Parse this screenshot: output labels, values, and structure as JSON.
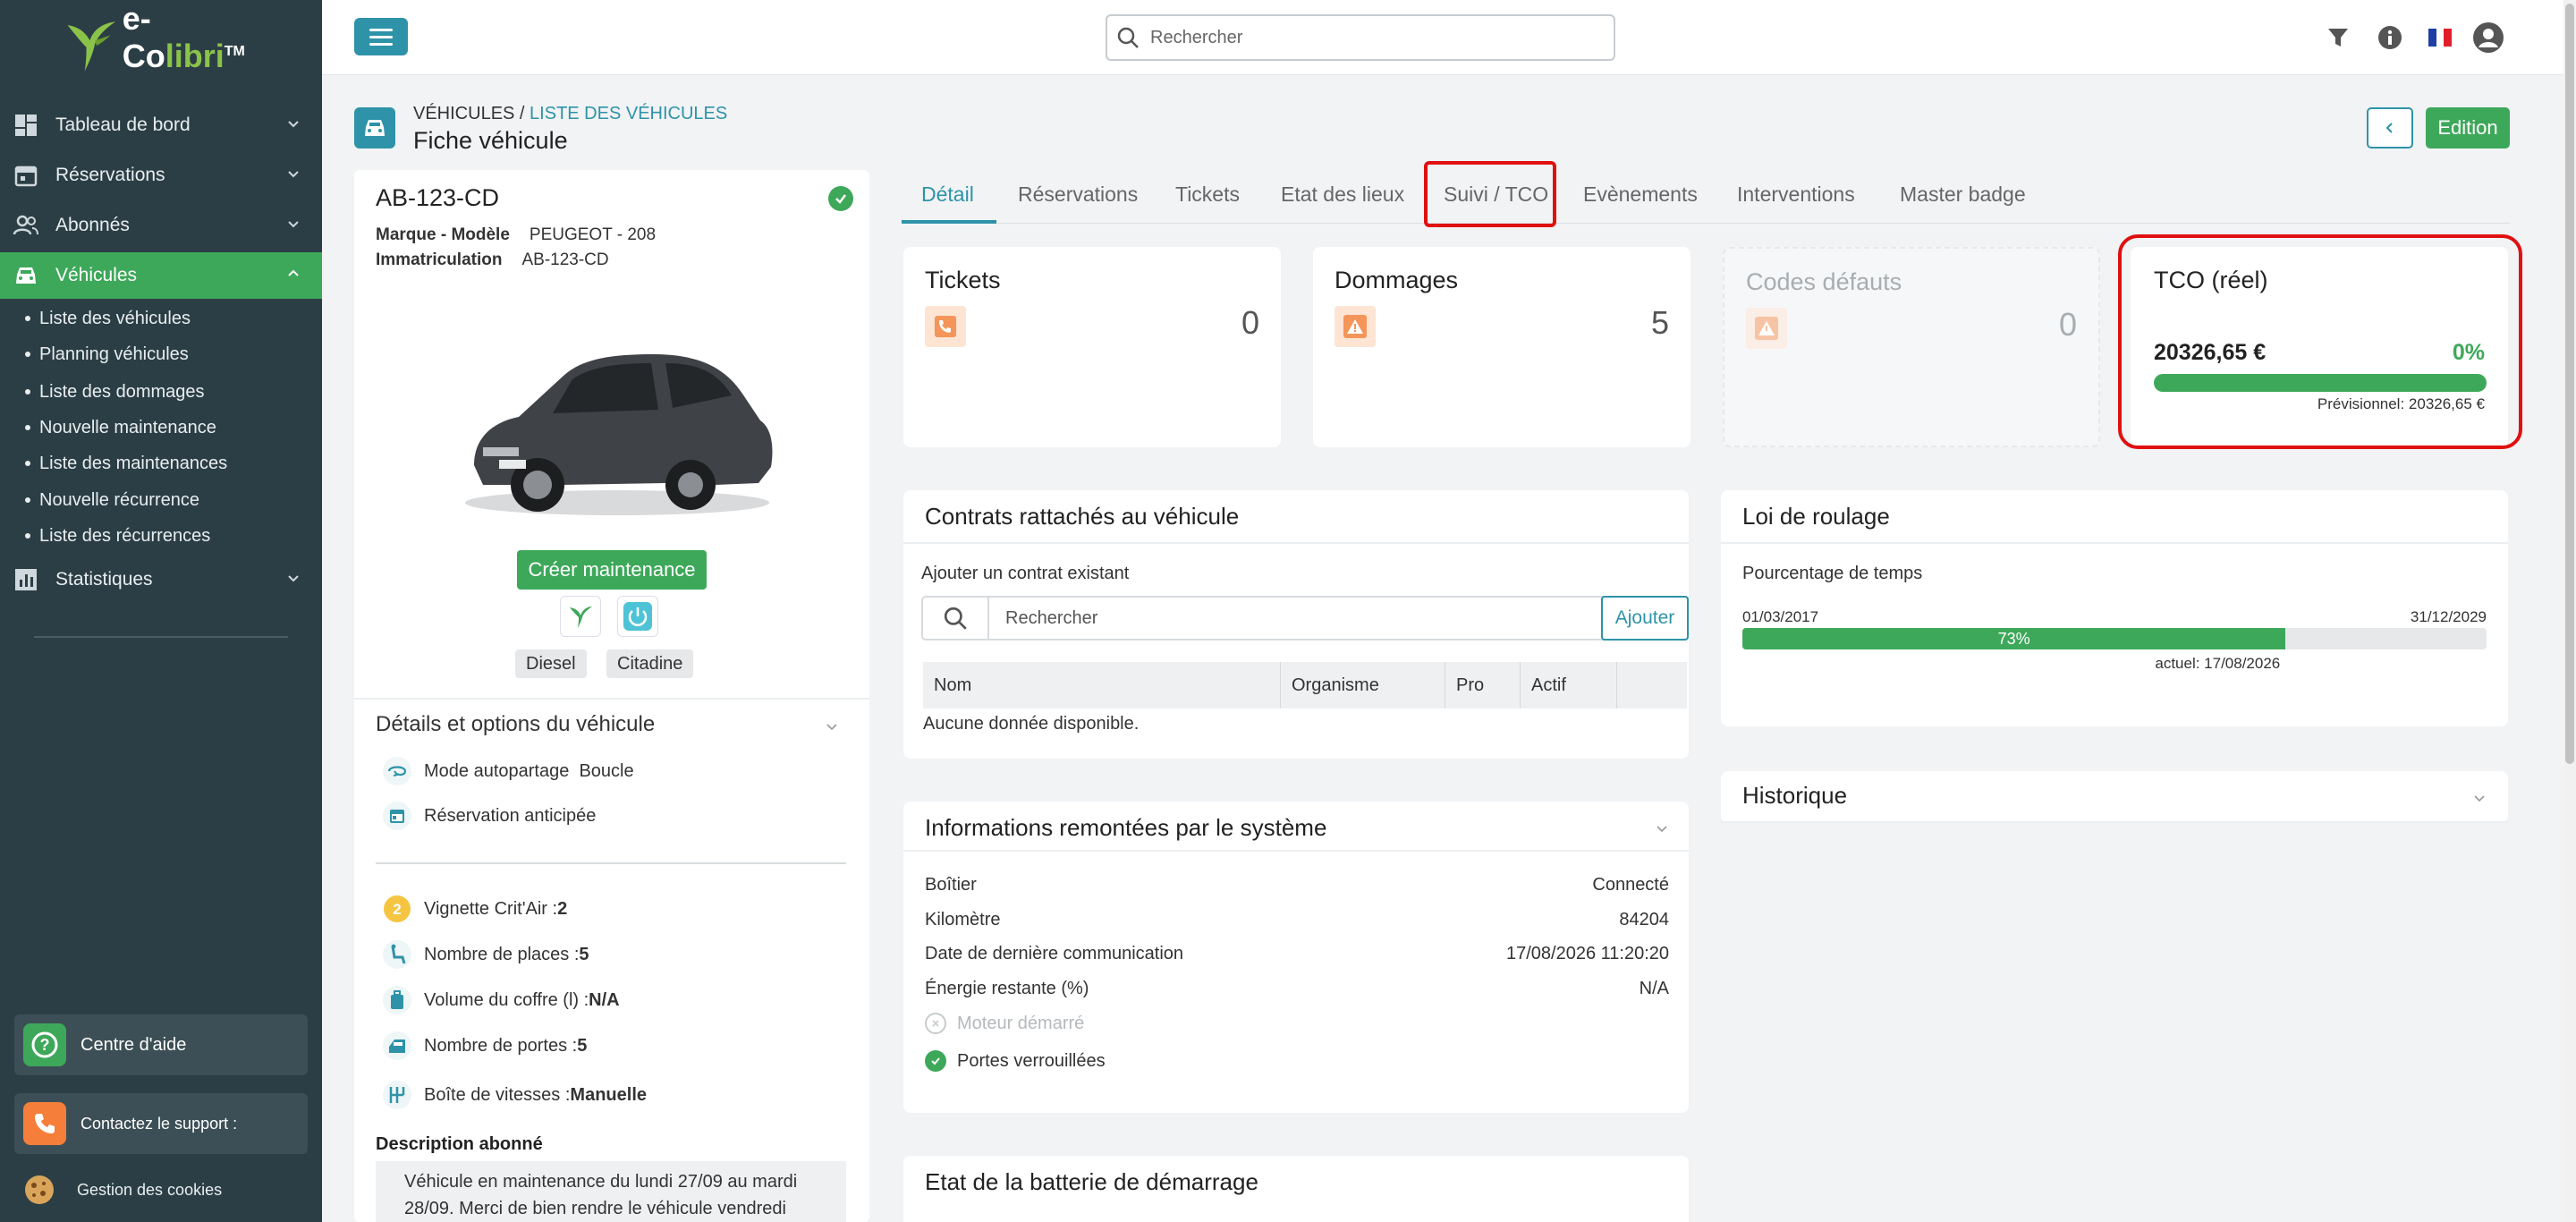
{
  "brand": {
    "name_e": "e-Co",
    "name_c": "libri",
    "tm": "TM"
  },
  "sidebar": {
    "items": [
      {
        "label": "Tableau de bord"
      },
      {
        "label": "Réservations"
      },
      {
        "label": "Abonnés"
      },
      {
        "label": "Véhicules"
      },
      {
        "label": "Statistiques"
      }
    ],
    "sub_items": [
      {
        "label": "Liste des véhicules"
      },
      {
        "label": "Planning véhicules"
      },
      {
        "label": "Liste des dommages"
      },
      {
        "label": "Nouvelle maintenance"
      },
      {
        "label": "Liste des maintenances"
      },
      {
        "label": "Nouvelle récurrence"
      },
      {
        "label": "Liste des récurrences"
      }
    ],
    "help": "Centre d'aide",
    "support": "Contactez le support :",
    "cookies": "Gestion des cookies"
  },
  "topbar": {
    "search_placeholder": "Rechercher"
  },
  "breadcrumb": {
    "root": "VÉHICULES",
    "separator": " / ",
    "link": "LISTE DES VÉHICULES"
  },
  "page_title": "Fiche véhicule",
  "edit_label": "Edition",
  "vehicle": {
    "plate": "AB-123-CD",
    "model_label": "Marque - Modèle",
    "model_value": "PEUGEOT - 208",
    "reg_label": "Immatriculation",
    "reg_value": "AB-123-CD",
    "create_maintenance": "Créer maintenance",
    "tags": [
      "Diesel",
      "Citadine"
    ],
    "details_title": "Détails et options du véhicule",
    "options": [
      {
        "label": "Mode autopartage",
        "value": "Boucle"
      },
      {
        "label": "Réservation anticipée",
        "value": ""
      }
    ],
    "specs": [
      {
        "label": "Vignette Crit'Air : ",
        "value": "2"
      },
      {
        "label": "Nombre de places : ",
        "value": "5"
      },
      {
        "label": "Volume du coffre (l) : ",
        "value": "N/A"
      },
      {
        "label": "Nombre de portes : ",
        "value": "5"
      },
      {
        "label": "Boîte de vitesses : ",
        "value": "Manuelle"
      }
    ],
    "critair_badge": "2",
    "desc_title": "Description abonné",
    "description": "Véhicule en maintenance du lundi 27/09 au mardi 28/09. Merci de bien rendre le véhicule vendredi"
  },
  "tabs": [
    {
      "label": "Détail"
    },
    {
      "label": "Réservations"
    },
    {
      "label": "Tickets"
    },
    {
      "label": "Etat des lieux"
    },
    {
      "label": "Suivi / TCO"
    },
    {
      "label": "Evènements"
    },
    {
      "label": "Interventions"
    },
    {
      "label": "Master badge"
    }
  ],
  "kpis": {
    "tickets": {
      "title": "Tickets",
      "value": "0"
    },
    "dommages": {
      "title": "Dommages",
      "value": "5"
    },
    "codes": {
      "title": "Codes défauts",
      "value": "0"
    },
    "tco": {
      "title": "TCO (réel)",
      "value": "20326,65 €",
      "percent": "0%",
      "forecast": "Prévisionnel:  20326,65 €"
    }
  },
  "contracts": {
    "title": "Contrats rattachés au véhicule",
    "add_label": "Ajouter un contrat existant",
    "search_placeholder": "Rechercher",
    "add_button": "Ajouter",
    "columns": [
      "Nom",
      "Organisme",
      "Pro",
      "Actif",
      ""
    ],
    "empty": "Aucune donnée disponible."
  },
  "system_info": {
    "title": "Informations remontées par le système",
    "rows": [
      {
        "label": "Boîtier",
        "value": "Connecté"
      },
      {
        "label": "Kilomètre",
        "value": "84204"
      },
      {
        "label": "Date de dernière communication",
        "value": "17/08/2026 11:20:20"
      },
      {
        "label": "Énergie restante (%)",
        "value": "N/A"
      }
    ],
    "engine": "Moteur démarré",
    "doors": "Portes verrouillées"
  },
  "battery": {
    "title": "Etat de la batterie de démarrage"
  },
  "loi": {
    "title": "Loi de roulage",
    "label": "Pourcentage de temps",
    "start": "01/03/2017",
    "end": "31/12/2029",
    "percent_label": "73%",
    "percent": 0.73,
    "now": "actuel: 17/08/2026"
  },
  "historique": {
    "title": "Historique"
  },
  "colors": {
    "primary": "#2e93a8",
    "success": "#3ea85a",
    "sidebar": "#2c3e45",
    "highlight": "#e01010"
  }
}
